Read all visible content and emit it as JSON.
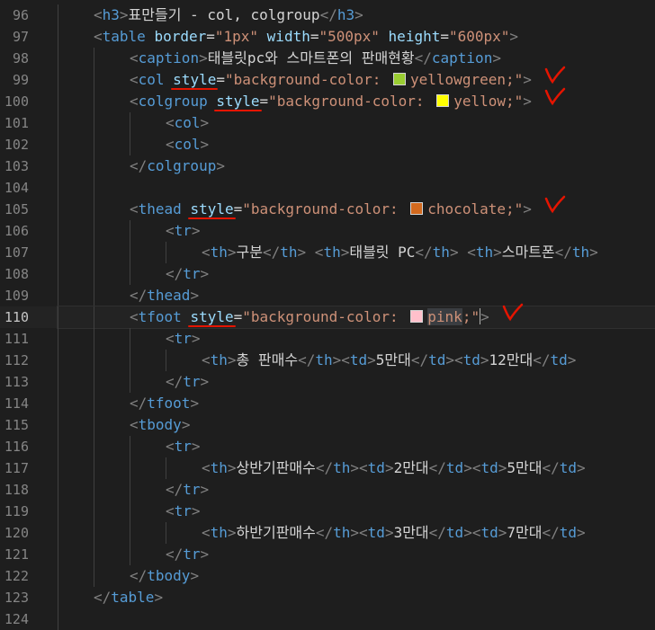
{
  "editor": {
    "lines": [
      {
        "n": "96",
        "guides": 1,
        "segments": [
          [
            "br",
            "<"
          ],
          [
            "tag",
            "h3"
          ],
          [
            "br",
            ">"
          ],
          [
            "txt",
            "표만들기 - col, colgroup"
          ],
          [
            "br",
            "</"
          ],
          [
            "tag",
            "h3"
          ],
          [
            "br",
            ">"
          ]
        ]
      },
      {
        "n": "97",
        "guides": 1,
        "segments": [
          [
            "br",
            "<"
          ],
          [
            "tag",
            "table "
          ],
          [
            "attr",
            "border"
          ],
          [
            "eq",
            "="
          ],
          [
            "str",
            "\"1px\" "
          ],
          [
            "attr",
            "width"
          ],
          [
            "eq",
            "="
          ],
          [
            "str",
            "\"500px\" "
          ],
          [
            "attr",
            "height"
          ],
          [
            "eq",
            "="
          ],
          [
            "str",
            "\"600px\""
          ],
          [
            "br",
            ">"
          ]
        ]
      },
      {
        "n": "98",
        "guides": 2,
        "segments": [
          [
            "br",
            "<"
          ],
          [
            "tag",
            "caption"
          ],
          [
            "br",
            ">"
          ],
          [
            "txt",
            "태블릿pc와 스마트폰의 판매현황"
          ],
          [
            "br",
            "</"
          ],
          [
            "tag",
            "caption"
          ],
          [
            "br",
            ">"
          ]
        ]
      },
      {
        "n": "99",
        "guides": 2,
        "segments": [
          [
            "br",
            "<"
          ],
          [
            "tag",
            "col "
          ],
          [
            "attr",
            "style"
          ],
          [
            "eq",
            "="
          ],
          [
            "str",
            "\"background-color: "
          ],
          [
            "swatch",
            "yellowgreen"
          ],
          [
            "str",
            "yellowgreen;\""
          ],
          [
            "br",
            ">"
          ]
        ],
        "mark": "v1"
      },
      {
        "n": "100",
        "guides": 2,
        "segments": [
          [
            "br",
            "<"
          ],
          [
            "tag",
            "colgroup "
          ],
          [
            "attr",
            "style"
          ],
          [
            "eq",
            "="
          ],
          [
            "str",
            "\"background-color: "
          ],
          [
            "swatch",
            "yellow"
          ],
          [
            "str",
            "yellow;\""
          ],
          [
            "br",
            ">"
          ]
        ],
        "mark": "v2"
      },
      {
        "n": "101",
        "guides": 3,
        "segments": [
          [
            "br",
            "<"
          ],
          [
            "tag",
            "col"
          ],
          [
            "br",
            ">"
          ]
        ]
      },
      {
        "n": "102",
        "guides": 3,
        "segments": [
          [
            "br",
            "<"
          ],
          [
            "tag",
            "col"
          ],
          [
            "br",
            ">"
          ]
        ]
      },
      {
        "n": "103",
        "guides": 2,
        "segments": [
          [
            "br",
            "</"
          ],
          [
            "tag",
            "colgroup"
          ],
          [
            "br",
            ">"
          ]
        ]
      },
      {
        "n": "104",
        "guides": 2,
        "segments": []
      },
      {
        "n": "105",
        "guides": 2,
        "segments": [
          [
            "br",
            "<"
          ],
          [
            "tag",
            "thead "
          ],
          [
            "attr",
            "style"
          ],
          [
            "eq",
            "="
          ],
          [
            "str",
            "\"background-color: "
          ],
          [
            "swatch",
            "chocolate"
          ],
          [
            "str",
            "chocolate;\""
          ],
          [
            "br",
            ">"
          ]
        ],
        "mark": "v3"
      },
      {
        "n": "106",
        "guides": 3,
        "segments": [
          [
            "br",
            "<"
          ],
          [
            "tag",
            "tr"
          ],
          [
            "br",
            ">"
          ]
        ]
      },
      {
        "n": "107",
        "guides": 4,
        "segments": [
          [
            "br",
            "<"
          ],
          [
            "tag",
            "th"
          ],
          [
            "br",
            ">"
          ],
          [
            "txt",
            "구분"
          ],
          [
            "br",
            "</"
          ],
          [
            "tag",
            "th"
          ],
          [
            "br",
            "> <"
          ],
          [
            "tag",
            "th"
          ],
          [
            "br",
            ">"
          ],
          [
            "txt",
            "태블릿 PC"
          ],
          [
            "br",
            "</"
          ],
          [
            "tag",
            "th"
          ],
          [
            "br",
            "> <"
          ],
          [
            "tag",
            "th"
          ],
          [
            "br",
            ">"
          ],
          [
            "txt",
            "스마트폰"
          ],
          [
            "br",
            "</"
          ],
          [
            "tag",
            "th"
          ],
          [
            "br",
            ">"
          ]
        ]
      },
      {
        "n": "108",
        "guides": 3,
        "segments": [
          [
            "br",
            "</"
          ],
          [
            "tag",
            "tr"
          ],
          [
            "br",
            ">"
          ]
        ]
      },
      {
        "n": "109",
        "guides": 2,
        "segments": [
          [
            "br",
            "</"
          ],
          [
            "tag",
            "thead"
          ],
          [
            "br",
            ">"
          ]
        ]
      },
      {
        "n": "110",
        "guides": 2,
        "current": true,
        "segments": [
          [
            "br",
            "<"
          ],
          [
            "tag",
            "tfoot "
          ],
          [
            "attr",
            "style"
          ],
          [
            "eq",
            "="
          ],
          [
            "str",
            "\"background-color: "
          ],
          [
            "swatch",
            "pink"
          ],
          [
            "sel",
            "pink"
          ],
          [
            "str",
            ";\""
          ],
          [
            "cursor",
            ""
          ],
          [
            "br",
            ">"
          ]
        ],
        "mark": "v4"
      },
      {
        "n": "111",
        "guides": 3,
        "segments": [
          [
            "br",
            "<"
          ],
          [
            "tag",
            "tr"
          ],
          [
            "br",
            ">"
          ]
        ]
      },
      {
        "n": "112",
        "guides": 4,
        "segments": [
          [
            "br",
            "<"
          ],
          [
            "tag",
            "th"
          ],
          [
            "br",
            ">"
          ],
          [
            "txt",
            "총 판매수"
          ],
          [
            "br",
            "</"
          ],
          [
            "tag",
            "th"
          ],
          [
            "br",
            "><"
          ],
          [
            "tag",
            "td"
          ],
          [
            "br",
            ">"
          ],
          [
            "txt",
            "5만대"
          ],
          [
            "br",
            "</"
          ],
          [
            "tag",
            "td"
          ],
          [
            "br",
            "><"
          ],
          [
            "tag",
            "td"
          ],
          [
            "br",
            ">"
          ],
          [
            "txt",
            "12만대"
          ],
          [
            "br",
            "</"
          ],
          [
            "tag",
            "td"
          ],
          [
            "br",
            ">"
          ]
        ]
      },
      {
        "n": "113",
        "guides": 3,
        "segments": [
          [
            "br",
            "</"
          ],
          [
            "tag",
            "tr"
          ],
          [
            "br",
            ">"
          ]
        ]
      },
      {
        "n": "114",
        "guides": 2,
        "segments": [
          [
            "br",
            "</"
          ],
          [
            "tag",
            "tfoot"
          ],
          [
            "br",
            ">"
          ]
        ]
      },
      {
        "n": "115",
        "guides": 2,
        "segments": [
          [
            "br",
            "<"
          ],
          [
            "tag",
            "tbody"
          ],
          [
            "br",
            ">"
          ]
        ]
      },
      {
        "n": "116",
        "guides": 3,
        "segments": [
          [
            "br",
            "<"
          ],
          [
            "tag",
            "tr"
          ],
          [
            "br",
            ">"
          ]
        ]
      },
      {
        "n": "117",
        "guides": 4,
        "segments": [
          [
            "br",
            "<"
          ],
          [
            "tag",
            "th"
          ],
          [
            "br",
            ">"
          ],
          [
            "txt",
            "상반기판매수"
          ],
          [
            "br",
            "</"
          ],
          [
            "tag",
            "th"
          ],
          [
            "br",
            "><"
          ],
          [
            "tag",
            "td"
          ],
          [
            "br",
            ">"
          ],
          [
            "txt",
            "2만대"
          ],
          [
            "br",
            "</"
          ],
          [
            "tag",
            "td"
          ],
          [
            "br",
            "><"
          ],
          [
            "tag",
            "td"
          ],
          [
            "br",
            ">"
          ],
          [
            "txt",
            "5만대"
          ],
          [
            "br",
            "</"
          ],
          [
            "tag",
            "td"
          ],
          [
            "br",
            ">"
          ]
        ]
      },
      {
        "n": "118",
        "guides": 3,
        "segments": [
          [
            "br",
            "</"
          ],
          [
            "tag",
            "tr"
          ],
          [
            "br",
            ">"
          ]
        ]
      },
      {
        "n": "119",
        "guides": 3,
        "segments": [
          [
            "br",
            "<"
          ],
          [
            "tag",
            "tr"
          ],
          [
            "br",
            ">"
          ]
        ]
      },
      {
        "n": "120",
        "guides": 4,
        "segments": [
          [
            "br",
            "<"
          ],
          [
            "tag",
            "th"
          ],
          [
            "br",
            ">"
          ],
          [
            "txt",
            "하반기판매수"
          ],
          [
            "br",
            "</"
          ],
          [
            "tag",
            "th"
          ],
          [
            "br",
            "><"
          ],
          [
            "tag",
            "td"
          ],
          [
            "br",
            ">"
          ],
          [
            "txt",
            "3만대"
          ],
          [
            "br",
            "</"
          ],
          [
            "tag",
            "td"
          ],
          [
            "br",
            "><"
          ],
          [
            "tag",
            "td"
          ],
          [
            "br",
            ">"
          ],
          [
            "txt",
            "7만대"
          ],
          [
            "br",
            "</"
          ],
          [
            "tag",
            "td"
          ],
          [
            "br",
            ">"
          ]
        ]
      },
      {
        "n": "121",
        "guides": 3,
        "segments": [
          [
            "br",
            "</"
          ],
          [
            "tag",
            "tr"
          ],
          [
            "br",
            ">"
          ]
        ]
      },
      {
        "n": "122",
        "guides": 2,
        "segments": [
          [
            "br",
            "</"
          ],
          [
            "tag",
            "tbody"
          ],
          [
            "br",
            ">"
          ]
        ]
      },
      {
        "n": "123",
        "guides": 1,
        "segments": [
          [
            "br",
            "</"
          ],
          [
            "tag",
            "table"
          ],
          [
            "br",
            ">"
          ]
        ]
      },
      {
        "n": "124",
        "guides": 1,
        "segments": []
      }
    ],
    "swatch_colors": {
      "yellowgreen": "#9acd32",
      "yellow": "#ffff00",
      "chocolate": "#d2691e",
      "pink": "#ffc0cb"
    },
    "annotation_color": "#e51400"
  }
}
